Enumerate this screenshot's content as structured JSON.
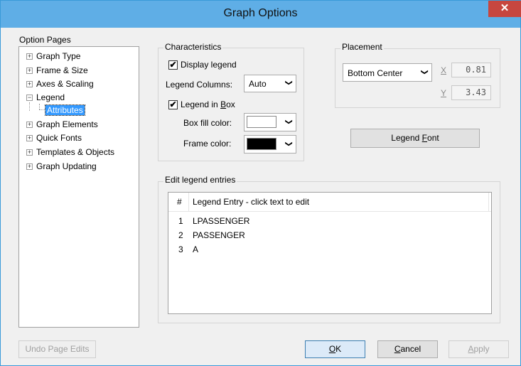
{
  "window": {
    "title": "Graph Options",
    "close_glyph": "✕"
  },
  "option_pages": {
    "label": "Option Pages",
    "items": [
      {
        "label": "Graph Type",
        "expander": "+"
      },
      {
        "label": "Frame & Size",
        "expander": "+"
      },
      {
        "label": "Axes & Scaling",
        "expander": "+"
      },
      {
        "label": "Legend",
        "expander": "−"
      },
      {
        "label": "Attributes",
        "expander": ""
      },
      {
        "label": "Graph Elements",
        "expander": "+"
      },
      {
        "label": "Quick Fonts",
        "expander": "+"
      },
      {
        "label": "Templates & Objects",
        "expander": "+"
      },
      {
        "label": "Graph Updating",
        "expander": "+"
      }
    ]
  },
  "characteristics": {
    "title": "Characteristics",
    "display_legend": {
      "label_pre": "Display legend",
      "checked": true
    },
    "legend_columns": {
      "label": "Legend Columns:",
      "value": "Auto"
    },
    "legend_in_box": {
      "label_pre": "Legend in ",
      "label_ul": "B",
      "label_post": "ox",
      "checked": true
    },
    "box_fill": {
      "label": "Box fill color:",
      "color": "#ffffff"
    },
    "frame_color": {
      "label": "Frame color:",
      "color": "#000000"
    }
  },
  "placement": {
    "title": "Placement",
    "position": "Bottom Center",
    "x_label": "X",
    "x_value": "0.81",
    "y_label": "Y",
    "y_value": "3.43"
  },
  "legend_font_button": {
    "pre": "Legend ",
    "ul": "F",
    "post": "ont"
  },
  "edit_entries": {
    "title": "Edit legend entries",
    "col_num": "#",
    "col_entry": "Legend Entry -  click text to edit",
    "rows": [
      {
        "num": "1",
        "text": "LPASSENGER"
      },
      {
        "num": "2",
        "text": "PASSENGER"
      },
      {
        "num": "3",
        "text": "A"
      }
    ]
  },
  "buttons": {
    "undo": "Undo Page Edits",
    "ok": {
      "ul": "O",
      "post": "K"
    },
    "cancel": {
      "ul": "C",
      "post": "ancel"
    },
    "apply": {
      "ul": "A",
      "post": "pply"
    }
  },
  "glyphs": {
    "check": "✔",
    "dropdown": "❯"
  }
}
